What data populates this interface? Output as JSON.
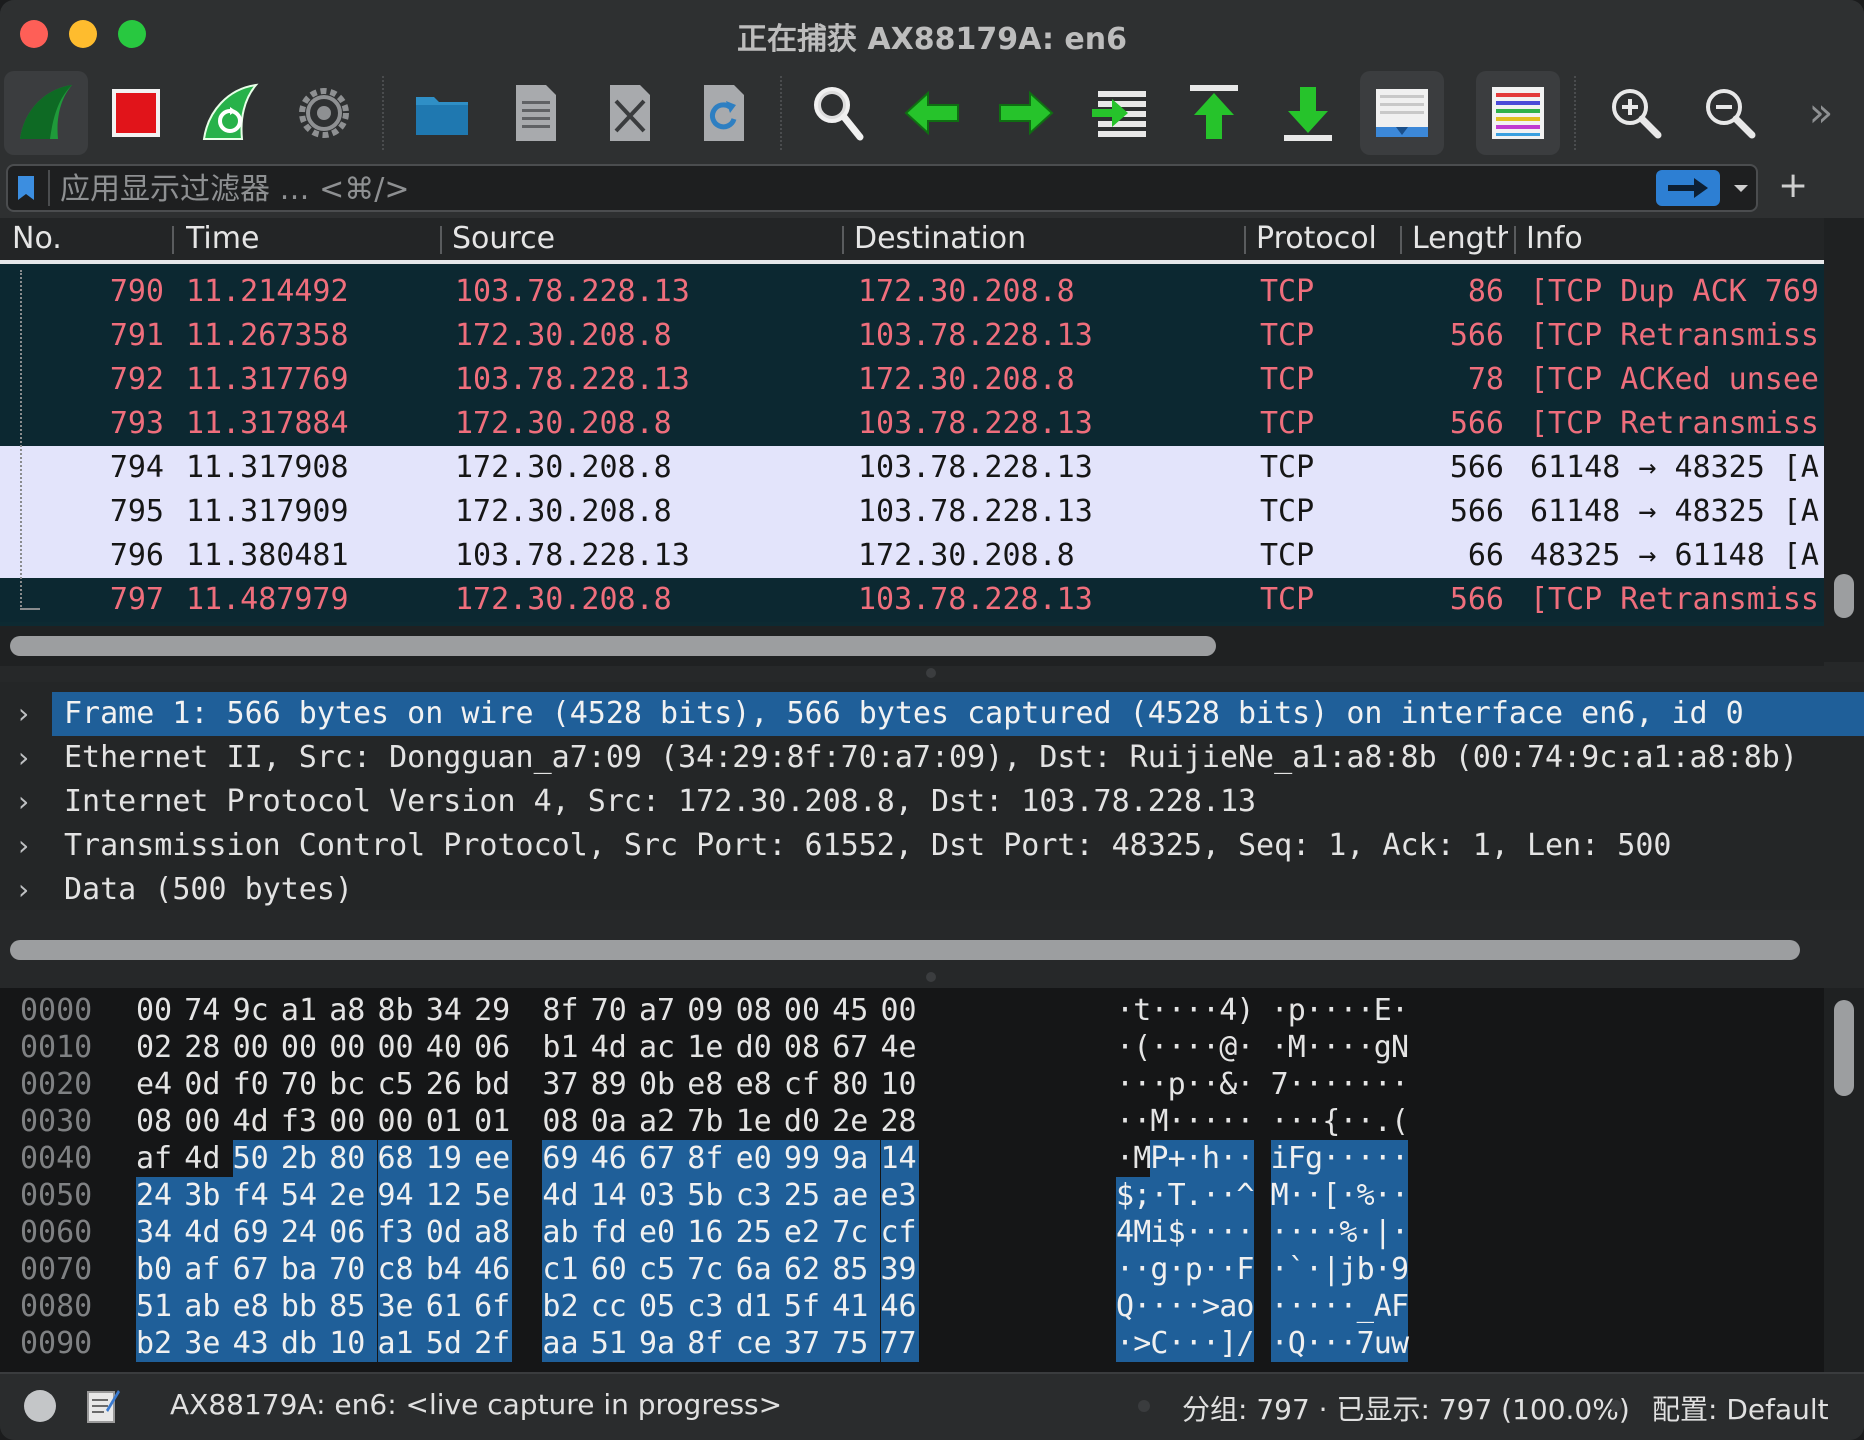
{
  "window": {
    "title": "正在捕获 AX88179A: en6"
  },
  "toolbar": {
    "buttons": [
      {
        "name": "start-capture",
        "icon": "shark-fin-icon"
      },
      {
        "name": "stop-capture",
        "icon": "stop-square-icon"
      },
      {
        "name": "restart-capture",
        "icon": "restart-fin-icon"
      },
      {
        "name": "capture-options",
        "icon": "gear-icon"
      },
      {
        "name": "open-file",
        "icon": "folder-icon"
      },
      {
        "name": "save-file",
        "icon": "binary-file-icon"
      },
      {
        "name": "close-file",
        "icon": "close-file-icon"
      },
      {
        "name": "reload-file",
        "icon": "reload-file-icon"
      },
      {
        "name": "find-packet",
        "icon": "magnifier-icon"
      },
      {
        "name": "go-back",
        "icon": "arrow-left-icon"
      },
      {
        "name": "go-forward",
        "icon": "arrow-right-icon"
      },
      {
        "name": "go-to-packet",
        "icon": "goto-packet-icon"
      },
      {
        "name": "go-first",
        "icon": "arrow-up-bar-icon"
      },
      {
        "name": "go-last",
        "icon": "arrow-down-bar-icon"
      },
      {
        "name": "auto-scroll",
        "icon": "autoscroll-icon"
      },
      {
        "name": "colorize",
        "icon": "colorize-lines-icon"
      },
      {
        "name": "zoom-in",
        "icon": "zoom-in-icon"
      },
      {
        "name": "zoom-out",
        "icon": "zoom-out-icon"
      },
      {
        "name": "more",
        "icon": "chevron-double-right-icon"
      }
    ],
    "overflow_label": "»"
  },
  "filter": {
    "placeholder": "应用显示过滤器 … <⌘/>",
    "value": "",
    "add_label": "+"
  },
  "packet_list": {
    "columns": [
      "No.",
      "Time",
      "Source",
      "Destination",
      "Protocol",
      "Length",
      "Info"
    ],
    "rows": [
      {
        "no": "790",
        "time": "11.214492",
        "src": "103.78.228.13",
        "dst": "172.30.208.8",
        "proto": "TCP",
        "len": "86",
        "info": "[TCP Dup ACK 769",
        "style": "bad"
      },
      {
        "no": "791",
        "time": "11.267358",
        "src": "172.30.208.8",
        "dst": "103.78.228.13",
        "proto": "TCP",
        "len": "566",
        "info": "[TCP Retransmiss",
        "style": "bad"
      },
      {
        "no": "792",
        "time": "11.317769",
        "src": "103.78.228.13",
        "dst": "172.30.208.8",
        "proto": "TCP",
        "len": "78",
        "info": "[TCP ACKed unsee",
        "style": "bad"
      },
      {
        "no": "793",
        "time": "11.317884",
        "src": "172.30.208.8",
        "dst": "103.78.228.13",
        "proto": "TCP",
        "len": "566",
        "info": "[TCP Retransmiss",
        "style": "bad"
      },
      {
        "no": "794",
        "time": "11.317908",
        "src": "172.30.208.8",
        "dst": "103.78.228.13",
        "proto": "TCP",
        "len": "566",
        "info": "61148 → 48325 [A",
        "style": "ok"
      },
      {
        "no": "795",
        "time": "11.317909",
        "src": "172.30.208.8",
        "dst": "103.78.228.13",
        "proto": "TCP",
        "len": "566",
        "info": "61148 → 48325 [A",
        "style": "ok"
      },
      {
        "no": "796",
        "time": "11.380481",
        "src": "103.78.228.13",
        "dst": "172.30.208.8",
        "proto": "TCP",
        "len": "66",
        "info": "48325 → 61148 [A",
        "style": "ok"
      },
      {
        "no": "797",
        "time": "11.487979",
        "src": "172.30.208.8",
        "dst": "103.78.228.13",
        "proto": "TCP",
        "len": "566",
        "info": "[TCP Retransmiss",
        "style": "bad"
      }
    ]
  },
  "details": {
    "items": [
      {
        "text": "Frame 1: 566 bytes on wire (4528 bits), 566 bytes captured (4528 bits) on interface en6, id 0",
        "selected": true
      },
      {
        "text": "Ethernet II, Src: Dongguan_a7:09 (34:29:8f:70:a7:09), Dst: RuijieNe_a1:a8:8b (00:74:9c:a1:a8:8b)",
        "selected": false
      },
      {
        "text": "Internet Protocol Version 4, Src: 172.30.208.8, Dst: 103.78.228.13",
        "selected": false
      },
      {
        "text": "Transmission Control Protocol, Src Port: 61552, Dst Port: 48325, Seq: 1, Ack: 1, Len: 500",
        "selected": false
      },
      {
        "text": "Data (500 bytes)",
        "selected": false
      }
    ],
    "expander": "›"
  },
  "hex_dump": {
    "selection_start_byte": 66,
    "rows": [
      {
        "offset": "0000",
        "bytes": [
          "00",
          "74",
          "9c",
          "a1",
          "a8",
          "8b",
          "34",
          "29",
          "8f",
          "70",
          "a7",
          "09",
          "08",
          "00",
          "45",
          "00"
        ],
        "ascii": [
          "·",
          "t",
          "·",
          "·",
          "·",
          "·",
          "4",
          ")",
          "·",
          "p",
          "·",
          "·",
          "·",
          "·",
          "E",
          "·"
        ]
      },
      {
        "offset": "0010",
        "bytes": [
          "02",
          "28",
          "00",
          "00",
          "00",
          "00",
          "40",
          "06",
          "b1",
          "4d",
          "ac",
          "1e",
          "d0",
          "08",
          "67",
          "4e"
        ],
        "ascii": [
          "·",
          "(",
          "·",
          "·",
          "·",
          "·",
          "@",
          "·",
          "·",
          "M",
          "·",
          "·",
          "·",
          "·",
          "g",
          "N"
        ]
      },
      {
        "offset": "0020",
        "bytes": [
          "e4",
          "0d",
          "f0",
          "70",
          "bc",
          "c5",
          "26",
          "bd",
          "37",
          "89",
          "0b",
          "e8",
          "e8",
          "cf",
          "80",
          "10"
        ],
        "ascii": [
          "·",
          "·",
          "·",
          "p",
          "·",
          "·",
          "&",
          "·",
          "7",
          "·",
          "·",
          "·",
          "·",
          "·",
          "·",
          "·"
        ]
      },
      {
        "offset": "0030",
        "bytes": [
          "08",
          "00",
          "4d",
          "f3",
          "00",
          "00",
          "01",
          "01",
          "08",
          "0a",
          "a2",
          "7b",
          "1e",
          "d0",
          "2e",
          "28"
        ],
        "ascii": [
          "·",
          "·",
          "M",
          "·",
          "·",
          "·",
          "·",
          "·",
          "·",
          "·",
          "·",
          "{",
          "·",
          "·",
          ".",
          "("
        ]
      },
      {
        "offset": "0040",
        "bytes": [
          "af",
          "4d",
          "50",
          "2b",
          "80",
          "68",
          "19",
          "ee",
          "69",
          "46",
          "67",
          "8f",
          "e0",
          "99",
          "9a",
          "14"
        ],
        "ascii": [
          "·",
          "M",
          "P",
          "+",
          "·",
          "h",
          "·",
          "·",
          "i",
          "F",
          "g",
          "·",
          "·",
          "·",
          "·",
          "·"
        ]
      },
      {
        "offset": "0050",
        "bytes": [
          "24",
          "3b",
          "f4",
          "54",
          "2e",
          "94",
          "12",
          "5e",
          "4d",
          "14",
          "03",
          "5b",
          "c3",
          "25",
          "ae",
          "e3"
        ],
        "ascii": [
          "$",
          ";",
          "·",
          "T",
          ".",
          "·",
          "·",
          "^",
          "M",
          "·",
          "·",
          "[",
          "·",
          "%",
          "·",
          "·"
        ]
      },
      {
        "offset": "0060",
        "bytes": [
          "34",
          "4d",
          "69",
          "24",
          "06",
          "f3",
          "0d",
          "a8",
          "ab",
          "fd",
          "e0",
          "16",
          "25",
          "e2",
          "7c",
          "cf"
        ],
        "ascii": [
          "4",
          "M",
          "i",
          "$",
          "·",
          "·",
          "·",
          "·",
          "·",
          "·",
          "·",
          "·",
          "%",
          "·",
          "|",
          "·"
        ]
      },
      {
        "offset": "0070",
        "bytes": [
          "b0",
          "af",
          "67",
          "ba",
          "70",
          "c8",
          "b4",
          "46",
          "c1",
          "60",
          "c5",
          "7c",
          "6a",
          "62",
          "85",
          "39"
        ],
        "ascii": [
          "·",
          "·",
          "g",
          "·",
          "p",
          "·",
          "·",
          "F",
          "·",
          "`",
          "·",
          "|",
          "j",
          "b",
          "·",
          "9"
        ]
      },
      {
        "offset": "0080",
        "bytes": [
          "51",
          "ab",
          "e8",
          "bb",
          "85",
          "3e",
          "61",
          "6f",
          "b2",
          "cc",
          "05",
          "c3",
          "d1",
          "5f",
          "41",
          "46"
        ],
        "ascii": [
          "Q",
          "·",
          "·",
          "·",
          "·",
          ">",
          "a",
          "o",
          "·",
          "·",
          "·",
          "·",
          "·",
          "_",
          "A",
          "F"
        ]
      },
      {
        "offset": "0090",
        "bytes": [
          "b2",
          "3e",
          "43",
          "db",
          "10",
          "a1",
          "5d",
          "2f",
          "aa",
          "51",
          "9a",
          "8f",
          "ce",
          "37",
          "75",
          "77"
        ],
        "ascii": [
          "·",
          ">",
          "C",
          "·",
          "·",
          "·",
          "]",
          "/",
          "·",
          "Q",
          "·",
          "·",
          "·",
          "7",
          "u",
          "w"
        ]
      }
    ]
  },
  "status": {
    "capture_text": "AX88179A: en6: <live capture in progress>",
    "packets_text": "分组: 797 · 已显示: 797 (100.0%)",
    "profile_text": "配置:  Default"
  },
  "colors": {
    "bad_row_bg": "#0c2831",
    "bad_row_fg": "#ef6e7c",
    "ok_row_bg": "#e3e4fb",
    "selection": "#1f5f99",
    "accent_blue": "#2d7fd3"
  }
}
